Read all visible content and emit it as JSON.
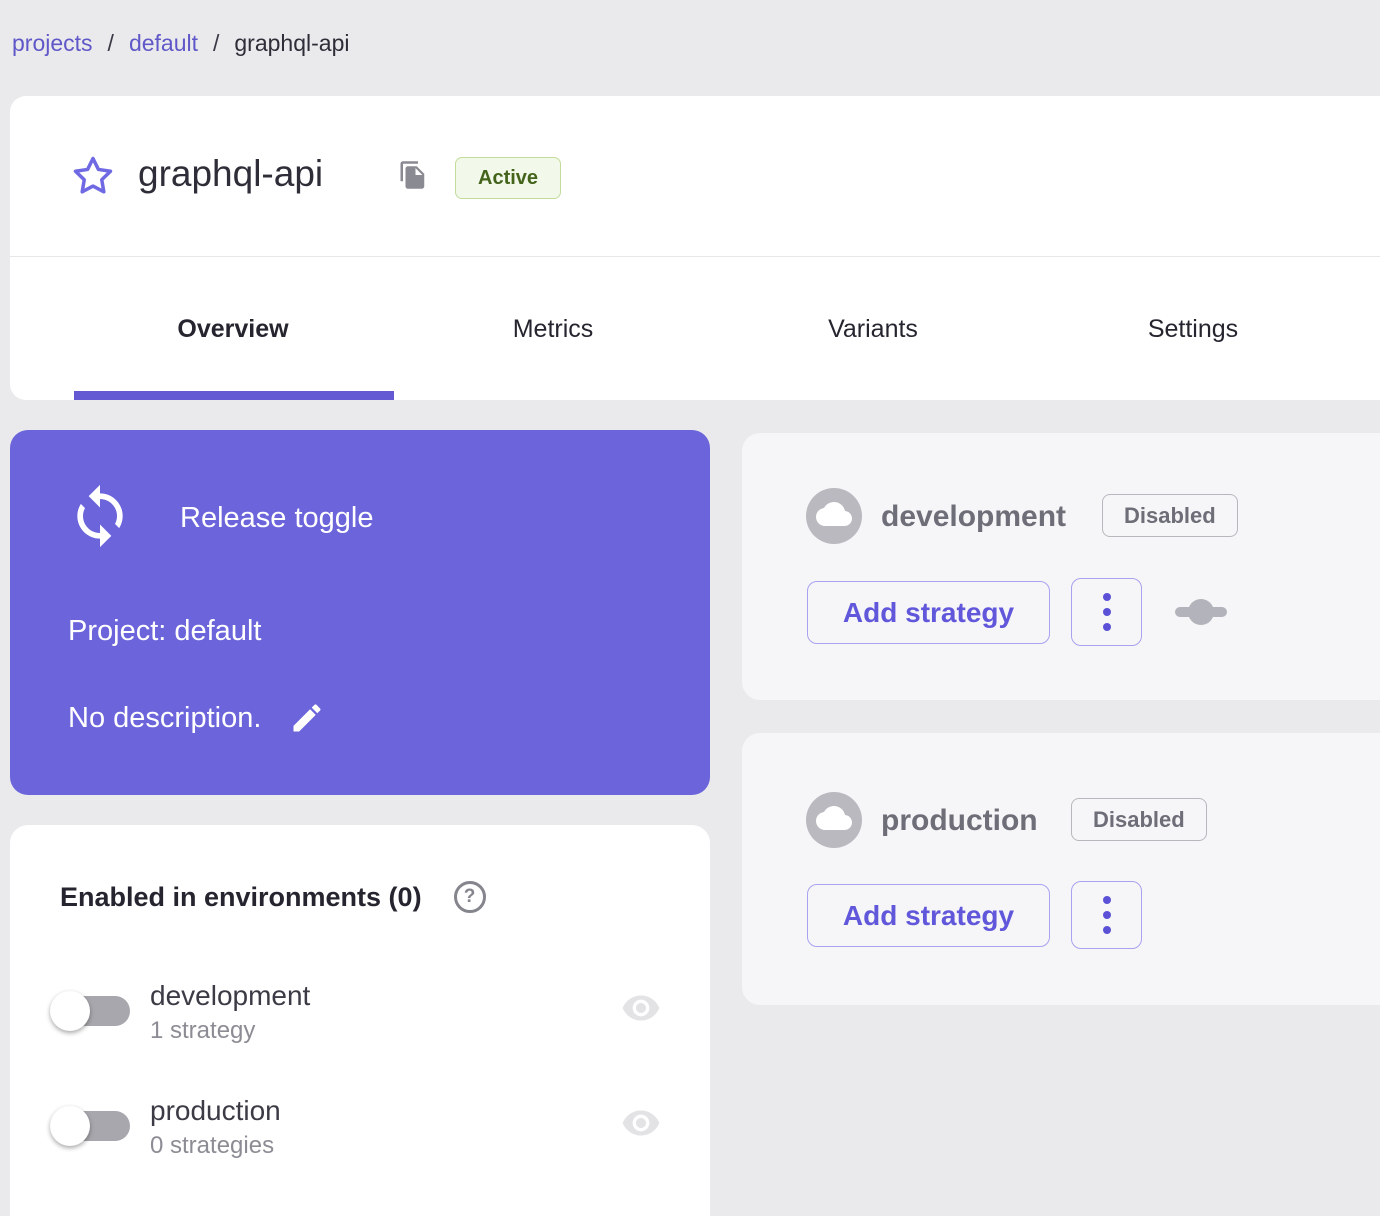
{
  "colors": {
    "page_bg": "#eaeaec",
    "card_bg": "#ffffff",
    "env_card_bg": "#f6f6f8",
    "accent_purple": "#6b64db",
    "link_purple": "#6058c8",
    "button_purple": "#6157da",
    "tab_indicator_purple": "#6459d3",
    "active_badge_text": "#44641c",
    "active_badge_bg": "#f3f9ea",
    "active_badge_border": "#c3dc9a",
    "disabled_chip_text": "#6e6e78",
    "muted_gray": "#8c8c94"
  },
  "breadcrumb": {
    "separator": "/",
    "items": [
      {
        "label": "projects"
      },
      {
        "label": "default"
      },
      {
        "label": "graphql-api"
      }
    ]
  },
  "header": {
    "title": "graphql-api",
    "status_badge": "Active",
    "tabs": [
      {
        "label": "Overview",
        "active": true
      },
      {
        "label": "Metrics",
        "active": false
      },
      {
        "label": "Variants",
        "active": false
      },
      {
        "label": "Settings",
        "active": false
      }
    ]
  },
  "info_card": {
    "type_label": "Release toggle",
    "project_label": "Project: default",
    "description": "No description."
  },
  "environments_summary": {
    "title": "Enabled in environments (0)",
    "help_glyph": "?",
    "rows": [
      {
        "name": "development",
        "strategies": "1 strategy",
        "enabled": false
      },
      {
        "name": "production",
        "strategies": "0 strategies",
        "enabled": false
      }
    ]
  },
  "environment_cards": [
    {
      "name": "development",
      "status": "Disabled",
      "add_button_label": "Add strategy"
    },
    {
      "name": "production",
      "status": "Disabled",
      "add_button_label": "Add strategy"
    }
  ]
}
